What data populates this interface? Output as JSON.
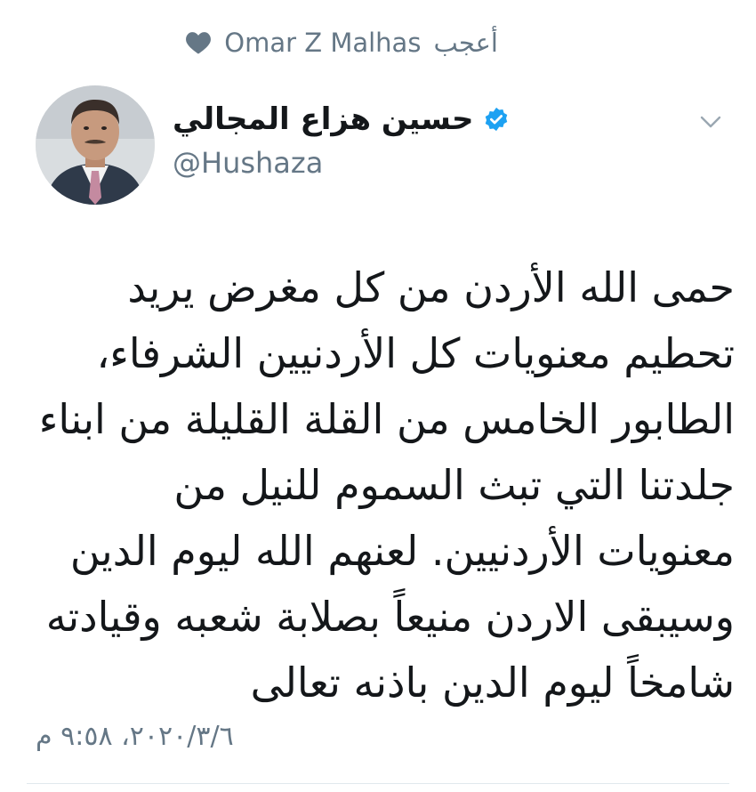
{
  "liked_by": {
    "user": "Omar Z Malhas",
    "action": "أعجب",
    "icon": "heart-icon"
  },
  "author": {
    "display_name": "حسين هزاع المجالي",
    "handle": "@Hushaza",
    "verified": true,
    "avatar": "avatar"
  },
  "tweet": {
    "text": "حمى الله الأردن من كل مغرض يريد تحطيم معنويات كل الأردنيين الشرفاء، الطابور الخامس من القلة القليلة من ابناء جلدتنا التي تبث السموم للنيل من معنويات الأردنيين. لعنهم الله ليوم الدين وسيبقى الاردن منيعاً بصلابة شعبه وقيادته شامخاً ليوم الدين باذنه تعالى",
    "timestamp": "٢٠٢٠/٣/٦، ٩:٥٨ م"
  },
  "colors": {
    "text": "#14171a",
    "secondary": "#657786",
    "verified_blue": "#1da1f2",
    "divider": "#e1e8ed"
  }
}
